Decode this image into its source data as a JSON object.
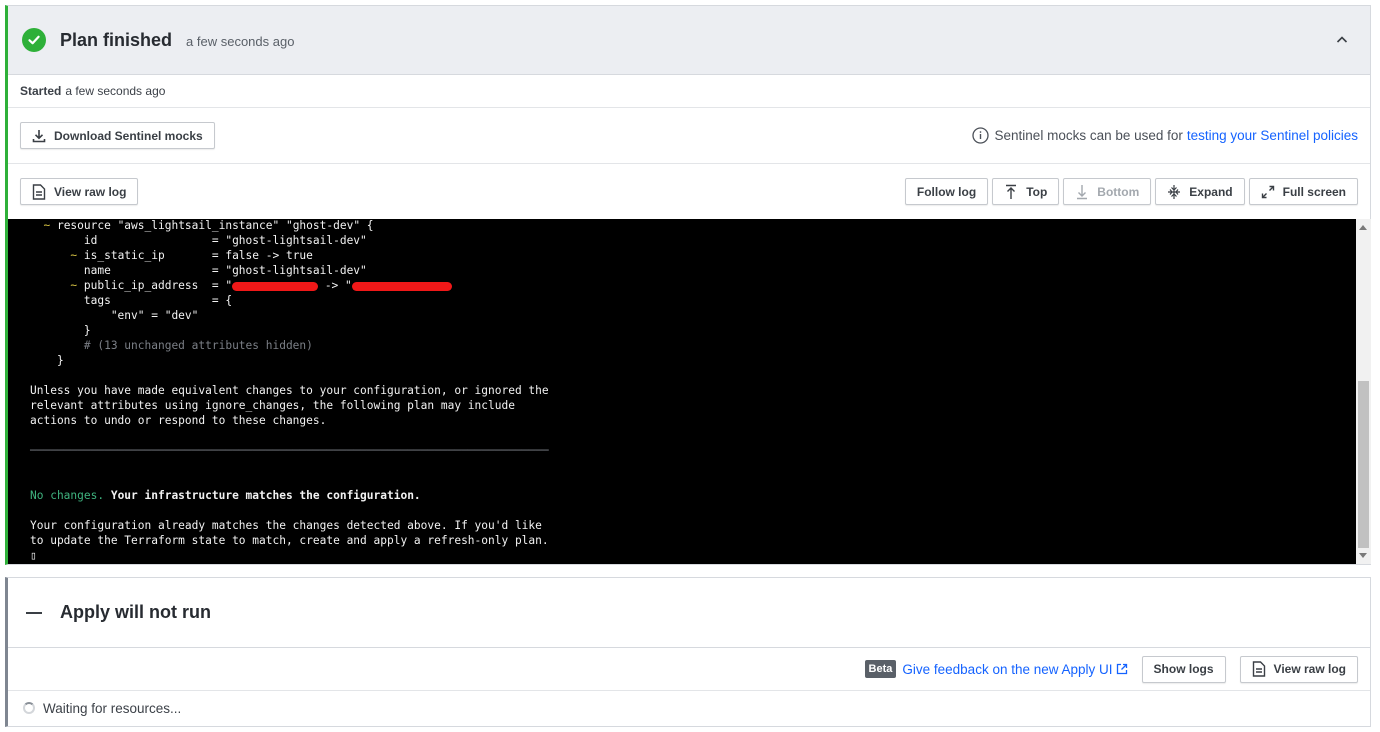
{
  "plan": {
    "title": "Plan finished",
    "time": "a few seconds ago",
    "started_label": "Started",
    "started_time": "a few seconds ago",
    "status_color": "#2eb039",
    "download_mocks_label": "Download Sentinel mocks",
    "sentinel_note": "Sentinel mocks can be used for",
    "sentinel_link": "testing your Sentinel policies",
    "view_raw_log_label": "View raw log",
    "toolbar": {
      "follow_log": "Follow log",
      "top": "Top",
      "bottom": "Bottom",
      "expand": "Expand",
      "full_screen": "Full screen"
    }
  },
  "log": {
    "lines": {
      "l1_prefix": "  ~ ",
      "l1": "resource \"aws_lightsail_instance\" \"ghost-dev\" {",
      "l2": "        id                 = \"ghost-lightsail-dev\"",
      "l3_prefix": "      ~ ",
      "l3": "is_static_ip       = false -> true",
      "l4": "        name               = \"ghost-lightsail-dev\"",
      "l5_prefix": "      ~ ",
      "l5_a": "public_ip_address  = \"",
      "l5_b": " -> \"",
      "l6": "        tags               = {",
      "l7": "            \"env\" = \"dev\"",
      "l8": "        }",
      "l9": "        # (13 unchanged attributes hidden)",
      "l10": "    }",
      "p1": "Unless you have made equivalent changes to your configuration, or ignored the\nrelevant attributes using ignore_changes, the following plan may include\nactions to undo or respond to these changes.",
      "rule": "─────────────────────────────────────────────────────────────────────────────",
      "no_changes": "No changes.",
      "matches": " Your infrastructure matches the configuration.",
      "p2": "Your configuration already matches the changes detected above. If you'd like\nto update the Terraform state to match, create and apply a refresh-only plan.",
      "cursor": "▯"
    }
  },
  "apply": {
    "title": "Apply will not run",
    "beta": "Beta",
    "feedback_link": "Give feedback on the new Apply UI",
    "show_logs": "Show logs",
    "view_raw_log": "View raw log",
    "waiting": "Waiting for resources..."
  }
}
